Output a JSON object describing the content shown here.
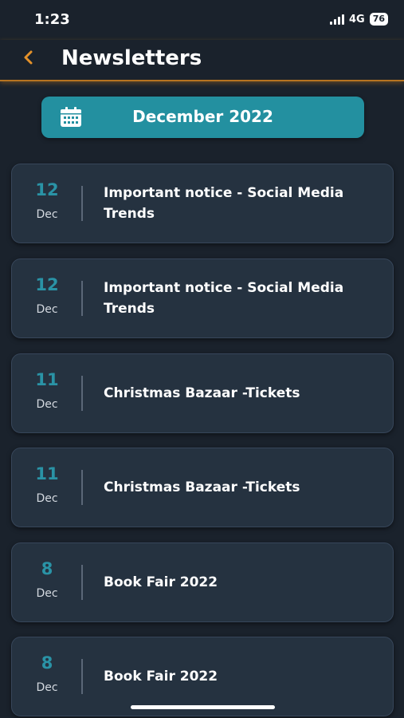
{
  "status_bar": {
    "time": "1:23",
    "network": "4G",
    "battery": "76"
  },
  "header": {
    "title": "Newsletters",
    "accent_color": "#b67421"
  },
  "month_selector": {
    "label": "December 2022",
    "color": "#2390a0"
  },
  "newsletters": [
    {
      "day": "12",
      "month": "Dec",
      "title": "Important notice - Social Media Trends"
    },
    {
      "day": "12",
      "month": "Dec",
      "title": "Important notice - Social Media Trends"
    },
    {
      "day": "11",
      "month": "Dec",
      "title": "Christmas Bazaar -Tickets"
    },
    {
      "day": "11",
      "month": "Dec",
      "title": "Christmas Bazaar -Tickets"
    },
    {
      "day": "8",
      "month": "Dec",
      "title": "Book Fair 2022"
    },
    {
      "day": "8",
      "month": "Dec",
      "title": "Book Fair 2022"
    }
  ],
  "icons": {
    "back": "chevron-left-icon",
    "calendar": "calendar-icon",
    "signal": "signal-icon",
    "battery": "battery-icon"
  }
}
